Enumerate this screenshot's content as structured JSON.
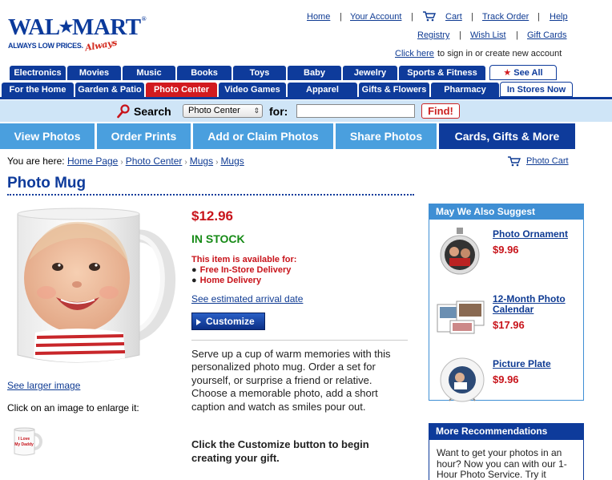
{
  "logo": {
    "brand_left": "WAL",
    "brand_right": "MART",
    "tagline": "ALWAYS LOW PRICES.",
    "tagline_script": "Always"
  },
  "top_links": {
    "home": "Home",
    "account": "Your Account",
    "cart": "Cart",
    "track": "Track Order",
    "help": "Help",
    "registry": "Registry",
    "wishlist": "Wish List",
    "giftcards": "Gift Cards",
    "click_here": "Click here",
    "signin_text": "to sign in or create new account"
  },
  "tabs_row1": [
    "Electronics",
    "Movies",
    "Music",
    "Books",
    "Toys",
    "Baby",
    "Jewelry",
    "Sports & Fitness",
    "See All"
  ],
  "tabs_row2": [
    "For the Home",
    "Garden & Patio",
    "Photo Center",
    "Video Games",
    "Apparel",
    "Gifts & Flowers",
    "Pharmacy",
    "In Stores Now"
  ],
  "search": {
    "label": "Search",
    "department": "Photo Center",
    "for_label": "for:",
    "query": "",
    "button": "Find!"
  },
  "photo_nav": [
    "View Photos",
    "Order Prints",
    "Add or Claim Photos",
    "Share Photos",
    "Cards, Gifts & More"
  ],
  "breadcrumb": {
    "prefix": "You are here:",
    "items": [
      "Home Page",
      "Photo Center",
      "Mugs",
      "Mugs"
    ],
    "photo_cart": "Photo Cart"
  },
  "product": {
    "title": "Photo Mug",
    "price": "$12.96",
    "stock": "IN STOCK",
    "available_label": "This item is available for:",
    "available_options": [
      "Free In-Store Delivery",
      "Home Delivery"
    ],
    "arrival_link": "See estimated arrival date",
    "customize": "Customize",
    "description": "Serve up a cup of warm memories with this personalized photo mug. Order a set for yourself, or surprise a friend or relative. Choose a memorable photo, add a short caption and watch as smiles pour out.",
    "cta": "Click the Customize button to begin creating your gift.",
    "see_larger": "See larger image",
    "click_enlarge": "Click on an image to enlarge it:",
    "thumb_text": "I Love My Daddy"
  },
  "suggest": {
    "heading": "May We Also Suggest",
    "items": [
      {
        "name": "Photo Ornament",
        "price": "$9.96"
      },
      {
        "name": "12-Month Photo Calendar",
        "price": "$17.96"
      },
      {
        "name": "Picture Plate",
        "price": "$9.96"
      }
    ]
  },
  "more": {
    "heading": "More Recommendations",
    "text": "Want to get your photos in an hour? Now you can with our 1-Hour Photo Service. Try it"
  },
  "colors": {
    "walmart_blue": "#0e3b9b",
    "active_tab_red": "#d21a1f",
    "price_red": "#c8141b",
    "stock_green": "#168a16",
    "photo_nav_blue": "#4a9fde",
    "search_bar_bg": "#cfe5f7"
  }
}
